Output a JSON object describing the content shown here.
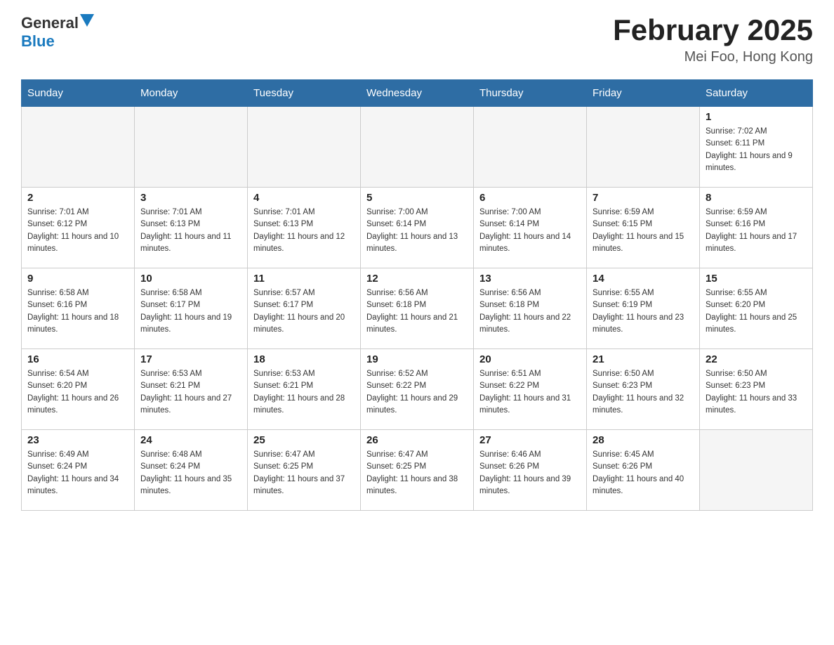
{
  "header": {
    "logo_general": "General",
    "logo_blue": "Blue",
    "title": "February 2025",
    "subtitle": "Mei Foo, Hong Kong"
  },
  "days_of_week": [
    "Sunday",
    "Monday",
    "Tuesday",
    "Wednesday",
    "Thursday",
    "Friday",
    "Saturday"
  ],
  "weeks": [
    [
      {
        "day": "",
        "sunrise": "",
        "sunset": "",
        "daylight": ""
      },
      {
        "day": "",
        "sunrise": "",
        "sunset": "",
        "daylight": ""
      },
      {
        "day": "",
        "sunrise": "",
        "sunset": "",
        "daylight": ""
      },
      {
        "day": "",
        "sunrise": "",
        "sunset": "",
        "daylight": ""
      },
      {
        "day": "",
        "sunrise": "",
        "sunset": "",
        "daylight": ""
      },
      {
        "day": "",
        "sunrise": "",
        "sunset": "",
        "daylight": ""
      },
      {
        "day": "1",
        "sunrise": "Sunrise: 7:02 AM",
        "sunset": "Sunset: 6:11 PM",
        "daylight": "Daylight: 11 hours and 9 minutes."
      }
    ],
    [
      {
        "day": "2",
        "sunrise": "Sunrise: 7:01 AM",
        "sunset": "Sunset: 6:12 PM",
        "daylight": "Daylight: 11 hours and 10 minutes."
      },
      {
        "day": "3",
        "sunrise": "Sunrise: 7:01 AM",
        "sunset": "Sunset: 6:13 PM",
        "daylight": "Daylight: 11 hours and 11 minutes."
      },
      {
        "day": "4",
        "sunrise": "Sunrise: 7:01 AM",
        "sunset": "Sunset: 6:13 PM",
        "daylight": "Daylight: 11 hours and 12 minutes."
      },
      {
        "day": "5",
        "sunrise": "Sunrise: 7:00 AM",
        "sunset": "Sunset: 6:14 PM",
        "daylight": "Daylight: 11 hours and 13 minutes."
      },
      {
        "day": "6",
        "sunrise": "Sunrise: 7:00 AM",
        "sunset": "Sunset: 6:14 PM",
        "daylight": "Daylight: 11 hours and 14 minutes."
      },
      {
        "day": "7",
        "sunrise": "Sunrise: 6:59 AM",
        "sunset": "Sunset: 6:15 PM",
        "daylight": "Daylight: 11 hours and 15 minutes."
      },
      {
        "day": "8",
        "sunrise": "Sunrise: 6:59 AM",
        "sunset": "Sunset: 6:16 PM",
        "daylight": "Daylight: 11 hours and 17 minutes."
      }
    ],
    [
      {
        "day": "9",
        "sunrise": "Sunrise: 6:58 AM",
        "sunset": "Sunset: 6:16 PM",
        "daylight": "Daylight: 11 hours and 18 minutes."
      },
      {
        "day": "10",
        "sunrise": "Sunrise: 6:58 AM",
        "sunset": "Sunset: 6:17 PM",
        "daylight": "Daylight: 11 hours and 19 minutes."
      },
      {
        "day": "11",
        "sunrise": "Sunrise: 6:57 AM",
        "sunset": "Sunset: 6:17 PM",
        "daylight": "Daylight: 11 hours and 20 minutes."
      },
      {
        "day": "12",
        "sunrise": "Sunrise: 6:56 AM",
        "sunset": "Sunset: 6:18 PM",
        "daylight": "Daylight: 11 hours and 21 minutes."
      },
      {
        "day": "13",
        "sunrise": "Sunrise: 6:56 AM",
        "sunset": "Sunset: 6:18 PM",
        "daylight": "Daylight: 11 hours and 22 minutes."
      },
      {
        "day": "14",
        "sunrise": "Sunrise: 6:55 AM",
        "sunset": "Sunset: 6:19 PM",
        "daylight": "Daylight: 11 hours and 23 minutes."
      },
      {
        "day": "15",
        "sunrise": "Sunrise: 6:55 AM",
        "sunset": "Sunset: 6:20 PM",
        "daylight": "Daylight: 11 hours and 25 minutes."
      }
    ],
    [
      {
        "day": "16",
        "sunrise": "Sunrise: 6:54 AM",
        "sunset": "Sunset: 6:20 PM",
        "daylight": "Daylight: 11 hours and 26 minutes."
      },
      {
        "day": "17",
        "sunrise": "Sunrise: 6:53 AM",
        "sunset": "Sunset: 6:21 PM",
        "daylight": "Daylight: 11 hours and 27 minutes."
      },
      {
        "day": "18",
        "sunrise": "Sunrise: 6:53 AM",
        "sunset": "Sunset: 6:21 PM",
        "daylight": "Daylight: 11 hours and 28 minutes."
      },
      {
        "day": "19",
        "sunrise": "Sunrise: 6:52 AM",
        "sunset": "Sunset: 6:22 PM",
        "daylight": "Daylight: 11 hours and 29 minutes."
      },
      {
        "day": "20",
        "sunrise": "Sunrise: 6:51 AM",
        "sunset": "Sunset: 6:22 PM",
        "daylight": "Daylight: 11 hours and 31 minutes."
      },
      {
        "day": "21",
        "sunrise": "Sunrise: 6:50 AM",
        "sunset": "Sunset: 6:23 PM",
        "daylight": "Daylight: 11 hours and 32 minutes."
      },
      {
        "day": "22",
        "sunrise": "Sunrise: 6:50 AM",
        "sunset": "Sunset: 6:23 PM",
        "daylight": "Daylight: 11 hours and 33 minutes."
      }
    ],
    [
      {
        "day": "23",
        "sunrise": "Sunrise: 6:49 AM",
        "sunset": "Sunset: 6:24 PM",
        "daylight": "Daylight: 11 hours and 34 minutes."
      },
      {
        "day": "24",
        "sunrise": "Sunrise: 6:48 AM",
        "sunset": "Sunset: 6:24 PM",
        "daylight": "Daylight: 11 hours and 35 minutes."
      },
      {
        "day": "25",
        "sunrise": "Sunrise: 6:47 AM",
        "sunset": "Sunset: 6:25 PM",
        "daylight": "Daylight: 11 hours and 37 minutes."
      },
      {
        "day": "26",
        "sunrise": "Sunrise: 6:47 AM",
        "sunset": "Sunset: 6:25 PM",
        "daylight": "Daylight: 11 hours and 38 minutes."
      },
      {
        "day": "27",
        "sunrise": "Sunrise: 6:46 AM",
        "sunset": "Sunset: 6:26 PM",
        "daylight": "Daylight: 11 hours and 39 minutes."
      },
      {
        "day": "28",
        "sunrise": "Sunrise: 6:45 AM",
        "sunset": "Sunset: 6:26 PM",
        "daylight": "Daylight: 11 hours and 40 minutes."
      },
      {
        "day": "",
        "sunrise": "",
        "sunset": "",
        "daylight": ""
      }
    ]
  ]
}
